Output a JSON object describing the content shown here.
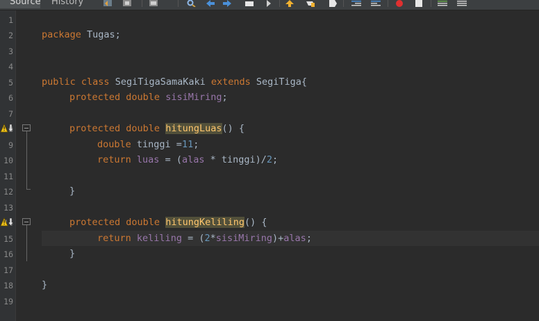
{
  "tabs": {
    "source": "Source",
    "history": "History"
  },
  "line_numbers": [
    "1",
    "2",
    "3",
    "4",
    "5",
    "6",
    "7",
    "8",
    "9",
    "10",
    "11",
    "12",
    "13",
    "14",
    "15",
    "16",
    "17",
    "18",
    "19"
  ],
  "code": {
    "l2": {
      "t1": "package",
      "t2": " Tugas;"
    },
    "l5": {
      "t1": "public",
      "t2": " ",
      "t3": "class",
      "t4": " SegiTigaSamaKaki ",
      "t5": "extends",
      "t6": " SegiTiga{"
    },
    "l6": {
      "t1": "protected",
      "t2": " ",
      "t3": "double",
      "t4": " ",
      "t5": "sisiMiring",
      "t6": ";"
    },
    "l8": {
      "t1": "protected",
      "t2": " ",
      "t3": "double",
      "t4": " ",
      "t5": "hitungLuas",
      "t6": "() {"
    },
    "l9": {
      "t1": "double",
      "t2": " tinggi =",
      "t3": "11",
      "t4": ";"
    },
    "l10": {
      "t1": "return",
      "t2": " ",
      "t3": "luas",
      "t4": " = (",
      "t5": "alas",
      "t6": " * tinggi)/",
      "t7": "2",
      "t8": ";"
    },
    "l12": {
      "t1": "}"
    },
    "l14": {
      "t1": "protected",
      "t2": " ",
      "t3": "double",
      "t4": " ",
      "t5": "hitungKeliling",
      "t6": "() {"
    },
    "l15": {
      "t1": "return",
      "t2": " ",
      "t3": "keliling",
      "t4": " = (",
      "t5": "2",
      "t6": "*",
      "t7": "sisiMiring",
      "t8": ")+",
      "t9": "alas",
      "t10": ";"
    },
    "l16": {
      "t1": "}"
    },
    "l18": {
      "t1": "}"
    }
  },
  "colors": {
    "keyword": "#cc7832",
    "field": "#9876aa",
    "number": "#6897bb",
    "method_highlight": "#ffc66d",
    "text": "#a9b7c6",
    "background": "#2b2b2b"
  },
  "icons": [
    "history-back-icon",
    "history-forward-icon",
    "find-icon",
    "prev-occurrence-icon",
    "next-occurrence-icon",
    "toggle-bookmark-icon",
    "run-macro-icon",
    "shift-left-icon",
    "shift-right-icon",
    "start-recording-icon",
    "stop-recording-icon",
    "comment-icon",
    "uncomment-icon",
    "override-warning-icon",
    "fold-collapse-icon"
  ]
}
